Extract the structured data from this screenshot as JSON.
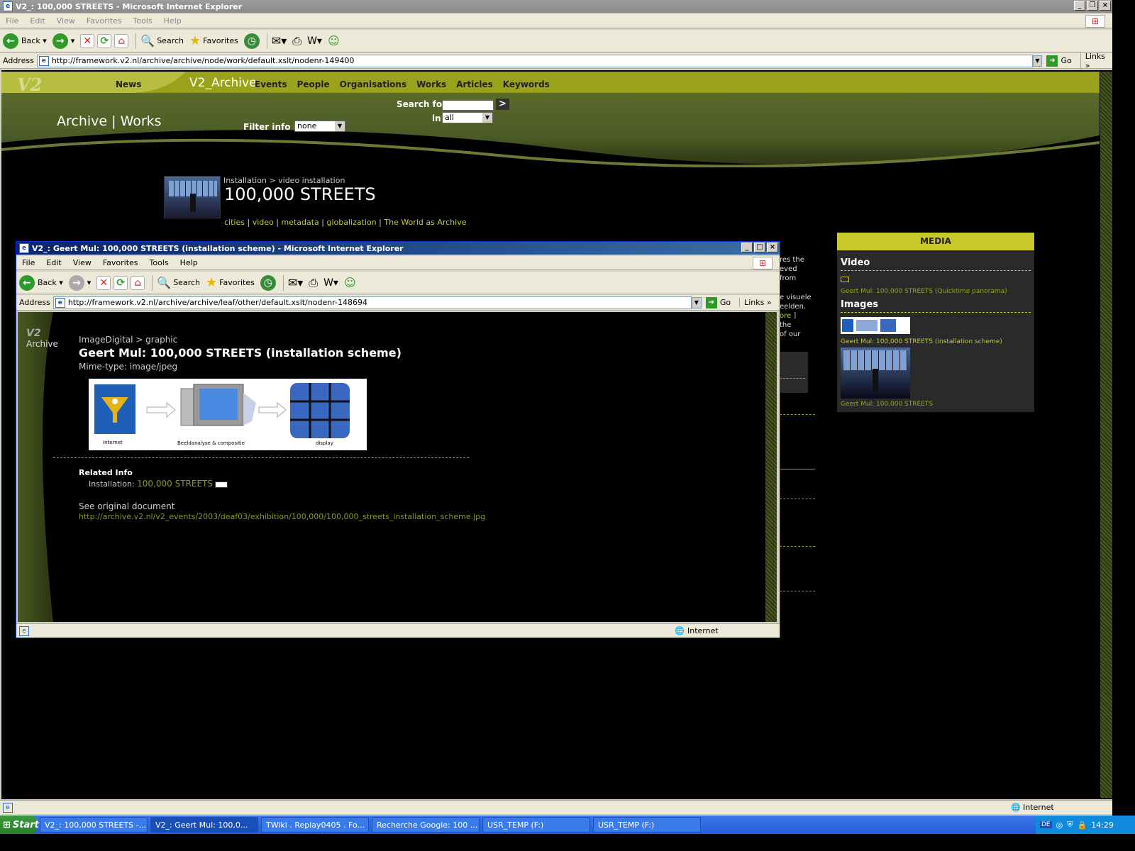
{
  "main_window": {
    "title": "V2_: 100,000 STREETS - Microsoft Internet Explorer",
    "menu": [
      "File",
      "Edit",
      "View",
      "Favorites",
      "Tools",
      "Help"
    ],
    "toolbar": {
      "back": "Back",
      "search": "Search",
      "favorites": "Favorites"
    },
    "address_label": "Address",
    "url": "http://framework.v2.nl/archive/archive/node/work/default.xslt/nodenr-149400",
    "go_label": "Go",
    "links_label": "Links",
    "status_zone": "Internet"
  },
  "v2_page": {
    "logo": "V2",
    "nav_news": "News",
    "nav_archive": "V2_Archive",
    "nav_items": [
      "Events",
      "People",
      "Organisations",
      "Works",
      "Articles",
      "Keywords"
    ],
    "section_title": "Archive | Works",
    "search_label": "Search for",
    "search_submit": ">",
    "in_label": "in",
    "in_value": "all",
    "filter_label": "Filter info by",
    "filter_value": "none",
    "breadcrumb": "Installation > video installation",
    "work_title": "100,000 STREETS",
    "tags": [
      "cities",
      "video",
      "metadata",
      "globalization",
      "The World as Archive"
    ],
    "partial_text": [
      "res the",
      "eved from",
      "e visuele",
      "eelden.",
      "ore ]",
      "the",
      "of our"
    ],
    "media": {
      "header": "MEDIA",
      "video_heading": "Video",
      "video_item": "Geert Mul: 100,000 STREETS (Quicktime panorama)",
      "images_heading": "Images",
      "image_item_1": "Geert Mul: 100,000 STREETS (installation scheme)",
      "image_item_2": "Geert Mul: 100,000 STREETS"
    }
  },
  "popup_window": {
    "title": "V2_: Geert Mul: 100,000 STREETS (installation scheme) - Microsoft Internet Explorer",
    "menu": [
      "File",
      "Edit",
      "View",
      "Favorites",
      "Tools",
      "Help"
    ],
    "toolbar": {
      "back": "Back",
      "search": "Search",
      "favorites": "Favorites"
    },
    "address_label": "Address",
    "url": "http://framework.v2.nl/archive/archive/leaf/other/default.xslt/nodenr-148694",
    "go_label": "Go",
    "links_label": "Links",
    "status_zone": "Internet",
    "archive_logo": "Archive",
    "breadcrumb": "ImageDigital > graphic",
    "title_text": "Geert Mul: 100,000 STREETS (installation scheme)",
    "mime": "Mime-type: image/jpeg",
    "scheme_labels": [
      "Internet",
      "Beeldanalyse & compositie",
      "display"
    ],
    "related_heading": "Related Info",
    "related_label": "Installation:",
    "related_link": "100,000 STREETS",
    "original_label": "See original document",
    "original_link": "http://archive.v2.nl/v2_events/2003/deaf03/exhibition/100,000/100,000_streets_installation_scheme.jpg"
  },
  "taskbar": {
    "start": "Start",
    "tasks": [
      "V2_: 100,000 STREETS -...",
      "V2_: Geert Mul: 100,0...",
      "TWiki . Replay0405 . Fo...",
      "Recherche Google: 100 ...",
      "USR_TEMP (F:)",
      "USR_TEMP (F:)"
    ],
    "lang": "DE",
    "clock": "14:29"
  },
  "colors": {
    "accent": "#9aa21c",
    "link": "#8f9520",
    "media_yellow": "#c9c92a"
  }
}
